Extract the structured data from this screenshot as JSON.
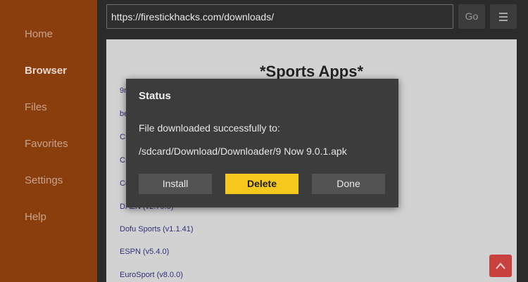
{
  "sidebar": {
    "items": [
      {
        "label": "Home"
      },
      {
        "label": "Browser"
      },
      {
        "label": "Files"
      },
      {
        "label": "Favorites"
      },
      {
        "label": "Settings"
      },
      {
        "label": "Help"
      }
    ],
    "active": "Browser"
  },
  "toolbar": {
    "url": "https://firestickhacks.com/downloads/",
    "go_label": "Go",
    "menu_icon": "hamburger-icon"
  },
  "page": {
    "heading": "*Sports Apps*",
    "links": [
      {
        "text": "9n"
      },
      {
        "text": "be"
      },
      {
        "text": "CE"
      },
      {
        "text": "CE"
      },
      {
        "text": "Co"
      },
      {
        "text": "DAZN (v2.79.0)"
      },
      {
        "text": "Dofu Sports (v1.1.41)"
      },
      {
        "text": "ESPN (v5.4.0)"
      },
      {
        "text": "EuroSport (v8.0.0)"
      }
    ],
    "scroll_top_icon": "chevron-up-icon"
  },
  "dialog": {
    "title": "Status",
    "message": "File downloaded successfully to:",
    "path": "/sdcard/Download/Downloader/9 Now 9.0.1.apk",
    "install_label": "Install",
    "delete_label": "Delete",
    "done_label": "Done"
  },
  "colors": {
    "sidebar_bg": "#8a3d0d",
    "accent_button": "#f4c81c",
    "scroll_button": "#c9413f"
  }
}
